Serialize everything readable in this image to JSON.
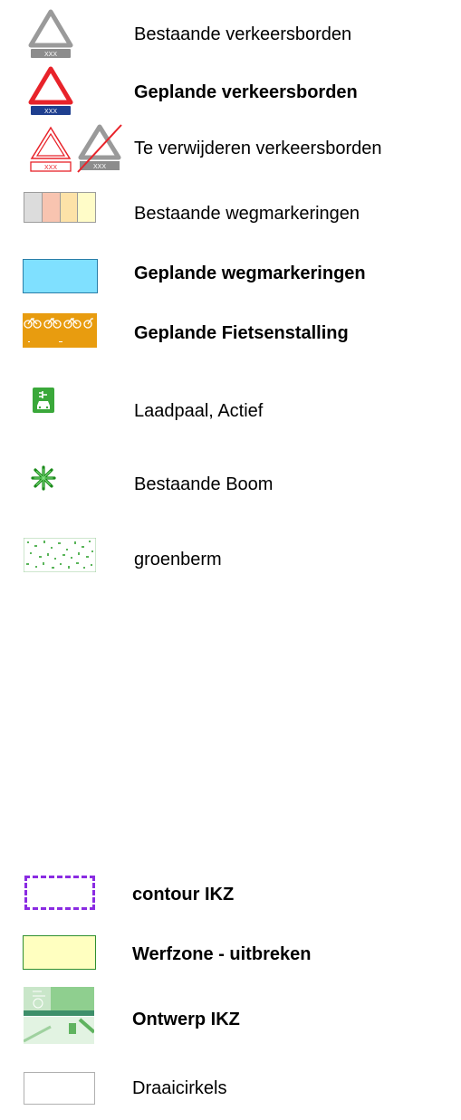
{
  "legend": {
    "items": [
      {
        "label": "Bestaande verkeersborden",
        "symbol": "existing-sign-icon",
        "sign_plate": "XXX",
        "bold": false
      },
      {
        "label": "Geplande verkeersborden",
        "symbol": "planned-sign-icon",
        "sign_plate": "XXX",
        "bold": true
      },
      {
        "label": "Te verwijderen verkeersborden",
        "symbol": "remove-sign-icon",
        "sign_plate": "XXX",
        "bold": false
      },
      {
        "label": "Bestaande wegmarkeringen",
        "symbol": "existing-markings-swatch",
        "bold": false
      },
      {
        "label": "Geplande wegmarkeringen",
        "symbol": "planned-markings-swatch",
        "bold": true
      },
      {
        "label": "Geplande Fietsenstalling",
        "symbol": "bike-parking-icon",
        "bold": true
      },
      {
        "label": "Laadpaal, Actief",
        "symbol": "charging-station-icon",
        "bold": false
      },
      {
        "label": "Bestaande Boom",
        "symbol": "tree-icon",
        "bold": false
      },
      {
        "label": "groenberm",
        "symbol": "green-verge-swatch",
        "bold": false
      }
    ],
    "items2": [
      {
        "label": "contour IKZ",
        "symbol": "contour-swatch",
        "bold": true
      },
      {
        "label": "Werfzone - uitbreken",
        "symbol": "worksite-swatch",
        "bold": true
      },
      {
        "label": "Ontwerp IKZ",
        "symbol": "design-thumbnail",
        "bold": true
      },
      {
        "label": "Draaicirkels",
        "symbol": "turning-circle-swatch",
        "bold": false
      }
    ]
  },
  "colors": {
    "existing_sign": "#9a9a9a",
    "planned_sign_red": "#e8232a",
    "planned_plate_blue": "#1f3f8f",
    "remove_red": "#e8232a",
    "planned_marking": "#7fe0ff",
    "bike_orange": "#e89c0f",
    "charging_green": "#3aa83a",
    "tree_green": "#1a8a1a",
    "contour_purple": "#8a2be2",
    "worksite_yellow": "#ffffc0"
  }
}
